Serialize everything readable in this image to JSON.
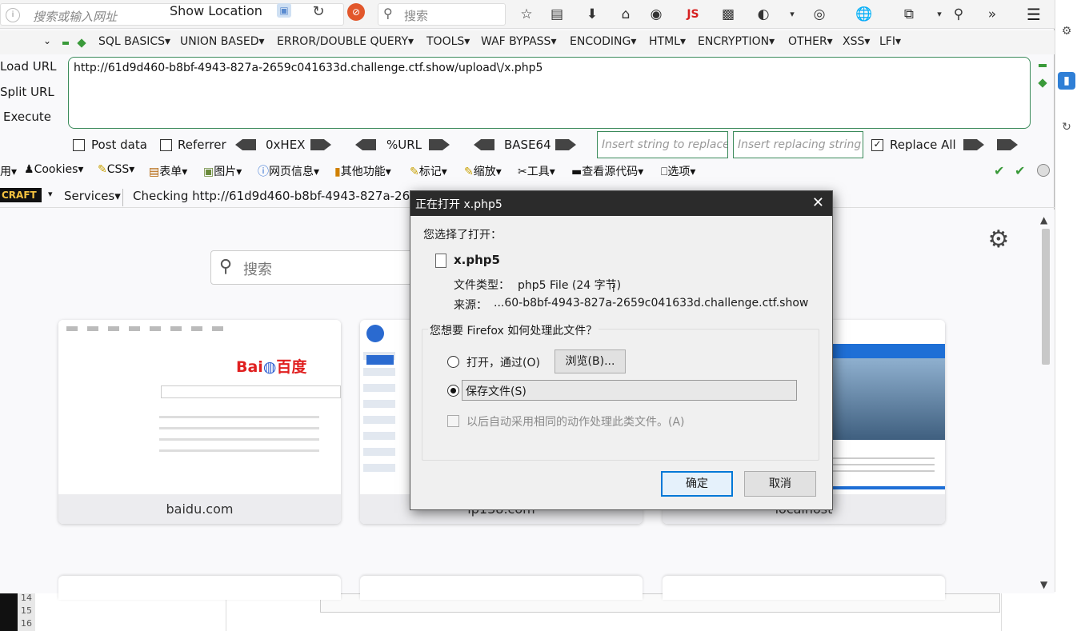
{
  "background": {
    "line_numbers": [
      "14",
      "15",
      "16"
    ]
  },
  "navbar": {
    "url_placeholder": "搜索或输入网址",
    "show_location": "Show Location",
    "search_placeholder": "搜索",
    "js_label": "JS"
  },
  "hackbar": {
    "menu": [
      "SQL BASICS▾",
      "UNION BASED▾",
      "ERROR/DOUBLE QUERY▾",
      "TOOLS▾",
      "WAF BYPASS▾",
      "ENCODING▾",
      "HTML▾",
      "ENCRYPTION▾",
      "OTHER▾",
      "XSS▾",
      "LFI▾"
    ],
    "load_url": "Load URL",
    "split_url": "Split URL",
    "execute": "Execute",
    "url_value": "http://61d9d460-b8bf-4943-827a-2659c041633d.challenge.ctf.show/upload\\/x.php5",
    "post_data": "Post data",
    "referrer": "Referrer",
    "hex": "0xHEX",
    "urlenc": "%URL",
    "base64": "BASE64",
    "insert_replace_placeholder": "Insert string to replace",
    "insert_replacing_placeholder": "Insert replacing string",
    "replace_all": "Replace All"
  },
  "webdev_toolbar": {
    "items": [
      "用▾",
      "Cookies▾",
      "CSS▾",
      "表单▾",
      "图片▾",
      "网页信息▾",
      "其他功能▾",
      "标记▾",
      "缩放▾",
      "工具▾",
      "查看源代码▾",
      "选项▾"
    ]
  },
  "status": {
    "craft": "CRAFT",
    "services": "Services▾",
    "checking": "Checking http://61d9d460-b8bf-4943-827a-2659"
  },
  "newtab": {
    "search_placeholder": "搜索",
    "tiles": [
      {
        "label": "baidu.com"
      },
      {
        "label": "ip138.com"
      },
      {
        "label": "localhost"
      }
    ]
  },
  "dialog": {
    "title": "正在打开 x.php5",
    "chose": "您选择了打开：",
    "file_name": "x.php5",
    "file_type_label": "文件类型：",
    "file_type_value": "php5 File (24 字节)",
    "source_label": "来源：",
    "source_value": "...60-b8bf-4943-827a-2659c041633d.challenge.ctf.show",
    "question": "您想要 Firefox 如何处理此文件？",
    "open_with": "打开，通过(O)",
    "browse": "浏览(B)...",
    "save_file": "保存文件(S)",
    "auto_action": "以后自动采用相同的动作处理此类文件。(A)",
    "ok": "确定",
    "cancel": "取消",
    "selected_option": "save_file"
  }
}
